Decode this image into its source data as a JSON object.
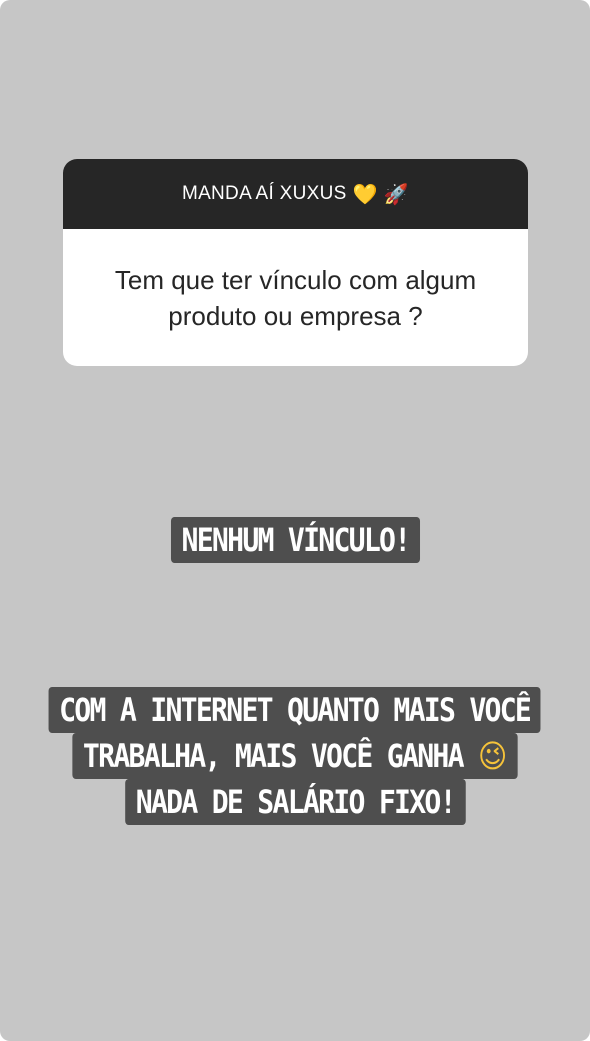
{
  "question_box": {
    "header": "MANDA AÍ XUXUS",
    "header_emojis": [
      "💛",
      "🚀"
    ],
    "question": "Tem que ter vínculo com algum produto ou empresa ?"
  },
  "captions": {
    "answer": "NENHUM VÍNCULO!",
    "line1": "COM A INTERNET QUANTO MAIS VOCÊ",
    "line2": "TRABALHA, MAIS VOCÊ GANHA",
    "line2_emoji": "😉",
    "line3": "NADA DE SALÁRIO FIXO!"
  },
  "colors": {
    "background": "#c6c6c6",
    "header_bg": "#262626",
    "caption_bg": "#4e4e4e"
  }
}
